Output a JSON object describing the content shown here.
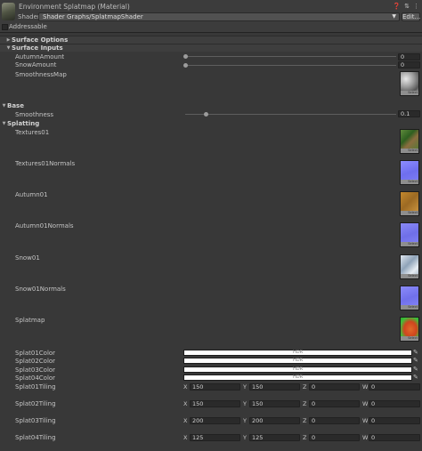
{
  "header": {
    "title": "Environment Splatmap (Material)",
    "icons": [
      "help-icon",
      "preset-icon",
      "more-icon"
    ],
    "shader_label": "Shader",
    "shader_value": "Shader Graphs/SplatmapShader",
    "edit_label": "Edit...",
    "addressable_label": "Addressable"
  },
  "sections": {
    "surface_options": "Surface Options",
    "surface_inputs": "Surface Inputs",
    "base": "Base",
    "splatting": "Splatting"
  },
  "surface_inputs": {
    "autumn_label": "AutumnAmount",
    "autumn_value": "0",
    "snow_label": "SnowAmount",
    "snow_value": "0",
    "smoothness_map_label": "SmoothnessMap"
  },
  "base": {
    "smoothness_label": "Smoothness",
    "smoothness_value": "0.1"
  },
  "splatting": {
    "textures": [
      {
        "label": "Textures01"
      },
      {
        "label": "Textures01Normals"
      },
      {
        "label": "Autumn01"
      },
      {
        "label": "Autumn01Normals"
      },
      {
        "label": "Snow01"
      },
      {
        "label": "Snow01Normals"
      },
      {
        "label": "Splatmap"
      }
    ],
    "select_label": "Select",
    "colors": [
      {
        "label": "Splat01Color",
        "hdr": "HDR"
      },
      {
        "label": "Splat02Color",
        "hdr": "HDR"
      },
      {
        "label": "Splat03Color",
        "hdr": "HDR"
      },
      {
        "label": "Splat04Color",
        "hdr": "HDR"
      }
    ],
    "tilings": [
      {
        "label": "Splat01Tiling",
        "x": "150",
        "y": "150",
        "z": "0",
        "w": "0"
      },
      {
        "label": "Splat02Tiling",
        "x": "150",
        "y": "150",
        "z": "0",
        "w": "0"
      },
      {
        "label": "Splat03Tiling",
        "x": "200",
        "y": "200",
        "z": "0",
        "w": "0"
      },
      {
        "label": "Splat04Tiling",
        "x": "125",
        "y": "125",
        "z": "0",
        "w": "0"
      }
    ],
    "axis_labels": {
      "x": "X",
      "y": "Y",
      "z": "Z",
      "w": "W"
    }
  },
  "colors": {
    "background": "#383838",
    "field": "#2a2a2a",
    "hdr_field": "#ffffff"
  }
}
